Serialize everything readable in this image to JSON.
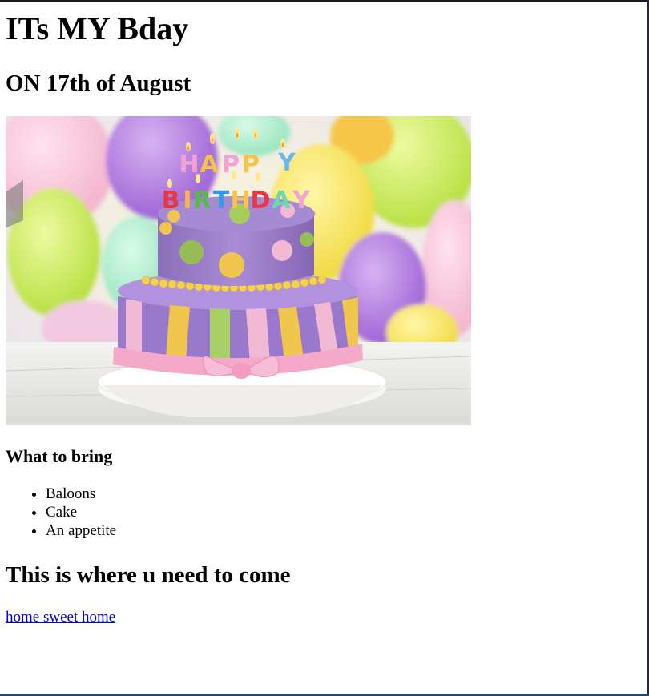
{
  "page": {
    "title": "ITs MY Bday",
    "date_heading": "ON 17th of August",
    "image": {
      "subject": "birthday-cake-photo",
      "cake_lettering": "HAPPY BIRTHDAY"
    },
    "bring_heading": "What to bring",
    "bring_items": [
      "Baloons",
      "Cake",
      "An appetite"
    ],
    "location_heading": "This is where u need to come",
    "location_link": "home sweet home"
  },
  "colors": {
    "link": "#0000ee",
    "text": "#000000"
  }
}
